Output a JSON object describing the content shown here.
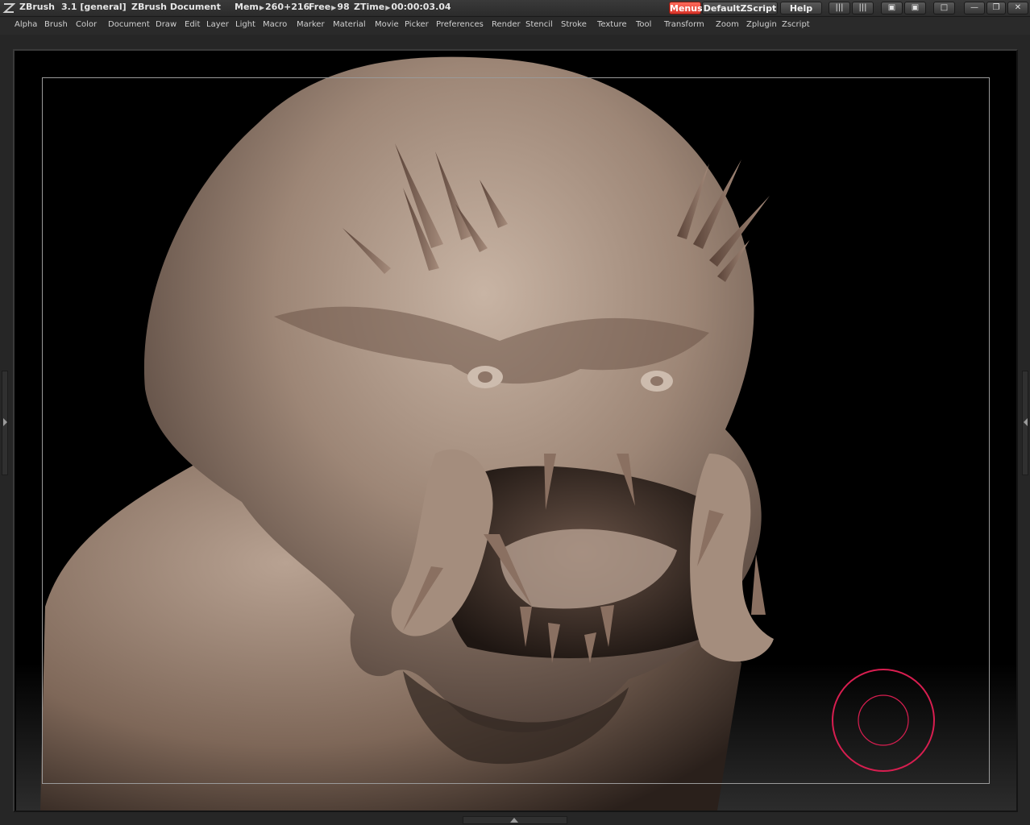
{
  "title_bar": {
    "app_name": "ZBrush",
    "version": "3.1 [general]",
    "document": "ZBrush Document",
    "mem_label": "Mem",
    "mem_value": "260+216",
    "free_label": "Free",
    "free_value": "98",
    "ztime_label": "ZTime",
    "ztime_value": "00:00:03.04",
    "menus_button": "Menus",
    "script_button": "DefaultZScript",
    "help_button": "Help"
  },
  "menu": {
    "items": [
      "Alpha",
      "Brush",
      "Color",
      "Document",
      "Draw",
      "Edit",
      "Layer",
      "Light",
      "Macro",
      "Marker",
      "Material",
      "Movie",
      "Picker",
      "Preferences",
      "Render",
      "Stencil",
      "Stroke",
      "Texture",
      "Tool",
      "Transform",
      "Zoom",
      "Zplugin",
      "Zscript"
    ]
  },
  "colors": {
    "accent": "#e83a2e",
    "brush_cursor": "#d81e50",
    "clay": "#9a8272",
    "background": "#000000"
  },
  "icons": {
    "logo": "zbrush-logo-icon",
    "cursor": "brush-cursor-icon"
  }
}
